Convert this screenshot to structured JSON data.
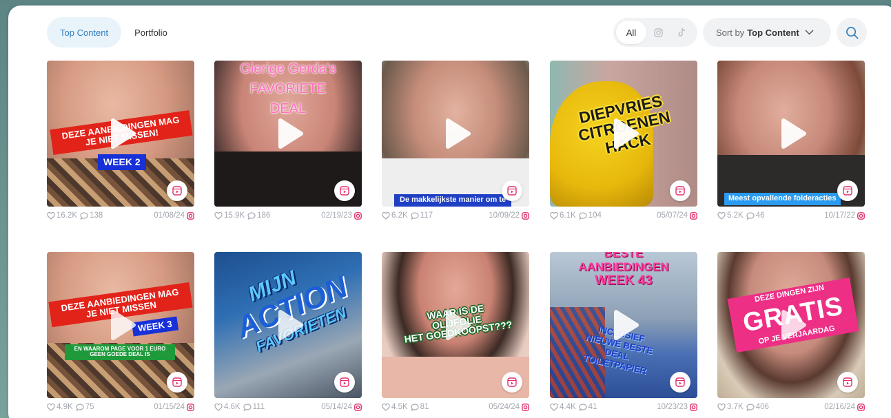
{
  "tabs": [
    {
      "label": "Top Content",
      "active": true
    },
    {
      "label": "Portfolio",
      "active": false
    }
  ],
  "filters": {
    "all_label": "All",
    "icons": [
      "instagram-icon",
      "tiktok-icon"
    ]
  },
  "sort": {
    "prefix": "Sort by",
    "value": "Top Content"
  },
  "accent_color": "#2f7fc0",
  "instagram_color": "#e1306c",
  "posts": [
    {
      "likes": "16.2K",
      "comments": "138",
      "date": "01/08/24",
      "captions": [
        "DEZE AANBIEDINGEN MAG",
        "JE NIET MISSEN!",
        "WEEK 2"
      ]
    },
    {
      "likes": "15.9K",
      "comments": "186",
      "date": "02/19/23",
      "captions": [
        "Gierige Gerda's",
        "FAVORIETE",
        "DEAL"
      ]
    },
    {
      "likes": "6.2K",
      "comments": "117",
      "date": "10/09/22",
      "captions": [
        "De makkelijkste manier om te"
      ]
    },
    {
      "likes": "6.1K",
      "comments": "104",
      "date": "05/07/24",
      "captions": [
        "DIEPVRIES",
        "CITROENEN",
        "HACK"
      ]
    },
    {
      "likes": "5.2K",
      "comments": "46",
      "date": "10/17/22",
      "captions": [
        "Meest opvallende folderacties"
      ]
    },
    {
      "likes": "4.9K",
      "comments": "75",
      "date": "01/15/24",
      "captions": [
        "DEZE AANBIEDINGEN MAG",
        "JE NIET MISSEN",
        "WEEK 3",
        "EN WAAROM PAGE VOOR 1 EURO",
        "GEEN GOEDE DEAL IS"
      ]
    },
    {
      "likes": "4.6K",
      "comments": "111",
      "date": "05/14/24",
      "captions": [
        "MIJN",
        "ACTION",
        "FAVORIETEN"
      ]
    },
    {
      "likes": "4.5K",
      "comments": "81",
      "date": "05/24/24",
      "captions": [
        "WAAR IS DE",
        "OLIJFOLIE",
        "HET GOEDKOOPST???"
      ]
    },
    {
      "likes": "4.4K",
      "comments": "41",
      "date": "10/23/23",
      "captions": [
        "BESTE",
        "AANBIEDINGEN",
        "WEEK 43",
        "INCLUSIEF",
        "NIEUWE BESTE",
        "DEAL",
        "TOILETPAPIER"
      ]
    },
    {
      "likes": "3.7K",
      "comments": "406",
      "date": "02/16/24",
      "captions": [
        "DEZE DINGEN ZIJN",
        "GRATIS",
        "OP JE VERJAARDAG"
      ]
    }
  ]
}
